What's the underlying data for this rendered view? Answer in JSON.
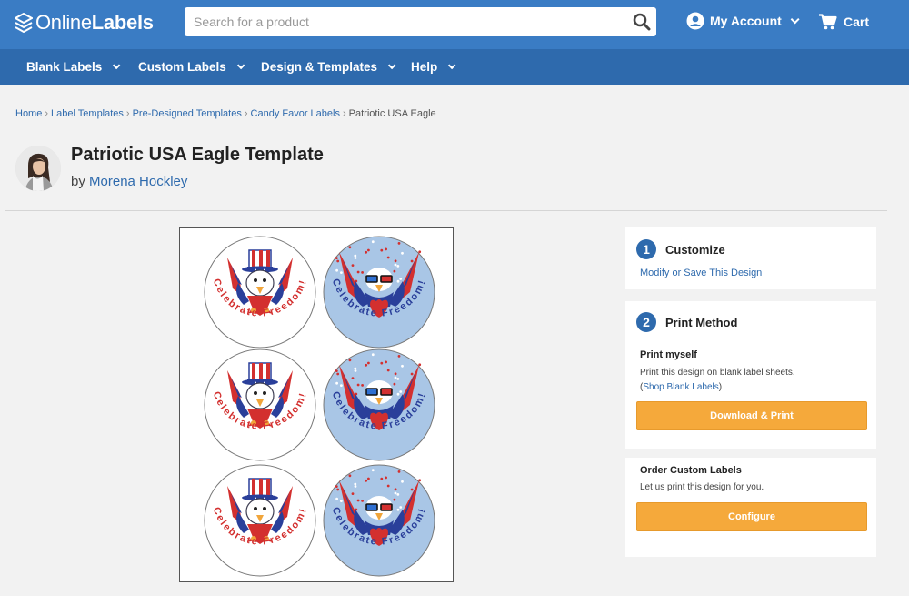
{
  "header": {
    "logo_light": "Online",
    "logo_bold": "Labels",
    "search_placeholder": "Search for a product",
    "account_label": "My Account",
    "cart_label": "Cart"
  },
  "nav": [
    {
      "label": "Blank Labels"
    },
    {
      "label": "Custom Labels"
    },
    {
      "label": "Design & Templates"
    },
    {
      "label": "Help"
    }
  ],
  "breadcrumb": [
    {
      "label": "Home"
    },
    {
      "label": "Label Templates"
    },
    {
      "label": "Pre-Designed Templates"
    },
    {
      "label": "Candy Favor Labels"
    },
    {
      "label": "Patriotic USA Eagle"
    }
  ],
  "page": {
    "title": "Patriotic USA Eagle Template",
    "by_prefix": "by",
    "author": "Morena Hockley"
  },
  "preview": {
    "label_text": "Celebrate Freedom!"
  },
  "customize": {
    "step": "1",
    "title": "Customize",
    "link": "Modify or Save This Design"
  },
  "print_method": {
    "step": "2",
    "title": "Print Method",
    "print_myself": {
      "title": "Print myself",
      "text": "Print this design on blank label sheets.",
      "link_open": "(",
      "link": "Shop Blank Labels",
      "link_close": ")",
      "button": "Download & Print"
    },
    "order_custom": {
      "title": "Order Custom Labels",
      "text": "Let us print this design for you.",
      "button": "Configure"
    }
  },
  "colors": {
    "header": "#3a7cc4",
    "nav": "#2e6aad",
    "button": "#f5a93b",
    "red": "#d3302f",
    "blue": "#2a3f9a",
    "light_blue": "#a9c6e6"
  }
}
